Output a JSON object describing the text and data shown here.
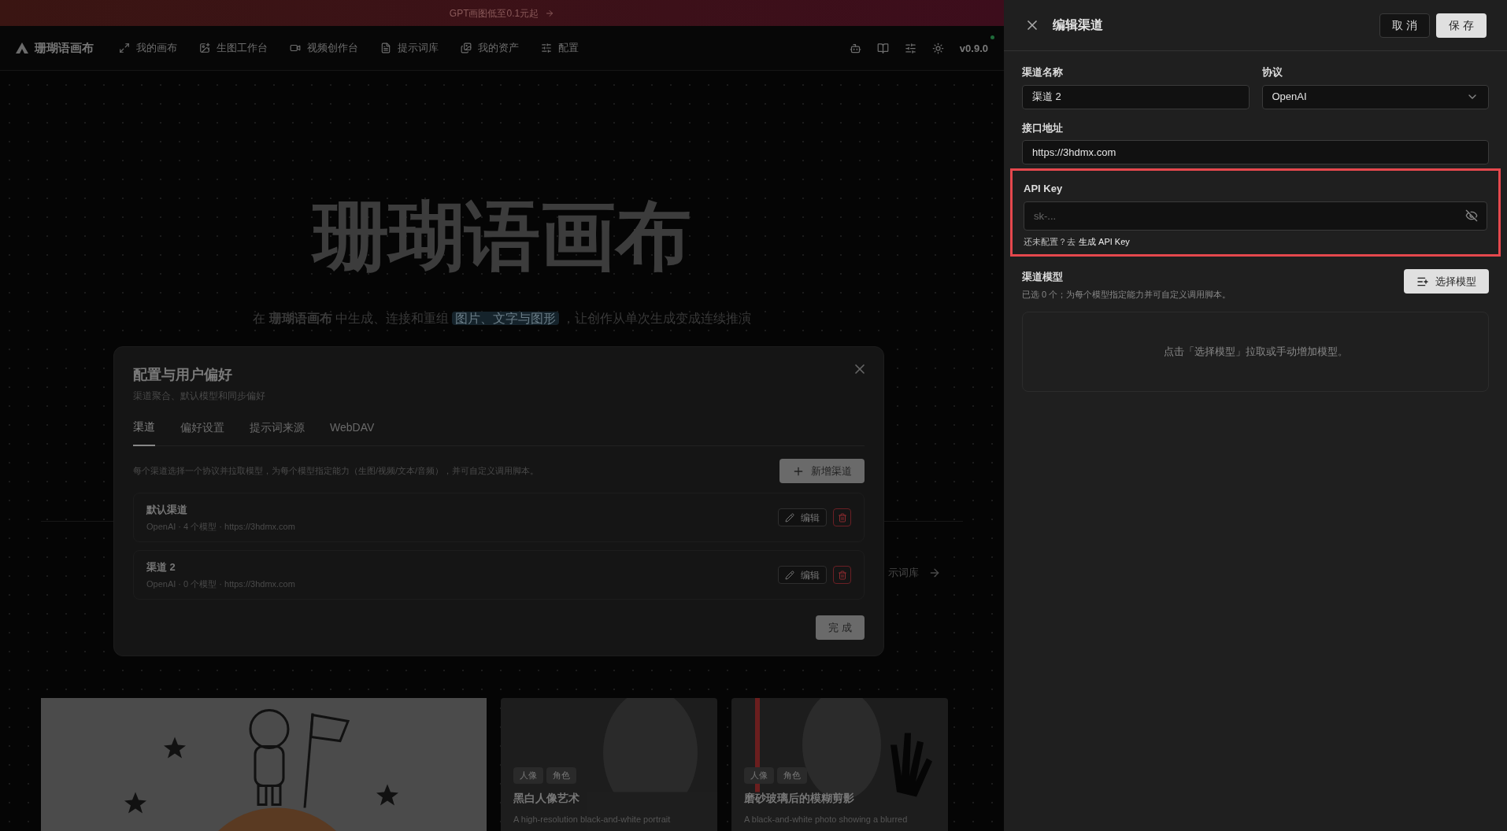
{
  "banner": {
    "text": "GPT画图低至0.1元起"
  },
  "nav": {
    "brand": "珊瑚语画布",
    "items": [
      {
        "label": "我的画布"
      },
      {
        "label": "生图工作台"
      },
      {
        "label": "视频创作台"
      },
      {
        "label": "提示词库"
      },
      {
        "label": "我的资产"
      },
      {
        "label": "配置"
      }
    ],
    "version": "v0.9.0",
    "online": true
  },
  "hero": {
    "title": "珊瑚语画布",
    "subtitle_before": "在 **珊瑚语画布** 中生成、连接和重组",
    "subtitle_highlight": "图片、文字与图形",
    "subtitle_after": "，让创作从单次生成变成连续推演",
    "link": "示词库"
  },
  "cards": [
    {
      "kind": "drawing"
    },
    {
      "tags": [
        "人像",
        "角色"
      ],
      "title": "黑白人像艺术",
      "description": "A high-resolution black-and-white portrait"
    },
    {
      "tags": [
        "人像",
        "角色"
      ],
      "title": "磨砂玻璃后的模糊剪影",
      "description": "A black-and-white photo showing a blurred"
    }
  ],
  "dialog": {
    "title": "配置与用户偏好",
    "subtitle": "渠道聚合、默认模型和同步偏好",
    "tabs": [
      {
        "label": "渠道",
        "selected": true
      },
      {
        "label": "偏好设置",
        "selected": false
      },
      {
        "label": "提示词来源",
        "selected": false
      },
      {
        "label": "WebDAV",
        "selected": false
      }
    ],
    "description": "每个渠道选择一个协议并拉取模型，为每个模型指定能力（生图/视频/文本/音频），并可自定义调用脚本。",
    "add_button": "新增渠道",
    "channels": [
      {
        "name": "默认渠道",
        "meta": "OpenAI · 4 个模型 · https://3hdmx.com",
        "edit": "编辑"
      },
      {
        "name": "渠道 2",
        "meta": "OpenAI · 0 个模型 · https://3hdmx.com",
        "edit": "编辑"
      }
    ],
    "done_button": "完 成"
  },
  "drawer": {
    "title": "编辑渠道",
    "cancel_button": "取 消",
    "save_button": "保 存",
    "name_label": "渠道名称",
    "name_value": "渠道 2",
    "protocol_label": "协议",
    "protocol_value": "OpenAI",
    "url_label": "接口地址",
    "url_value": "https://3hdmx.com",
    "key_label": "API Key",
    "key_placeholder": "sk-...",
    "key_highlighted": true,
    "key_hint": "还未配置？去",
    "key_link": "生成 API Key",
    "models_label": "渠道模型",
    "models_hint": "已选 0 个；为每个模型指定能力并可自定义调用脚本。",
    "select_button": "选择模型",
    "models_empty": "点击「选择模型」拉取或手动增加模型。"
  }
}
